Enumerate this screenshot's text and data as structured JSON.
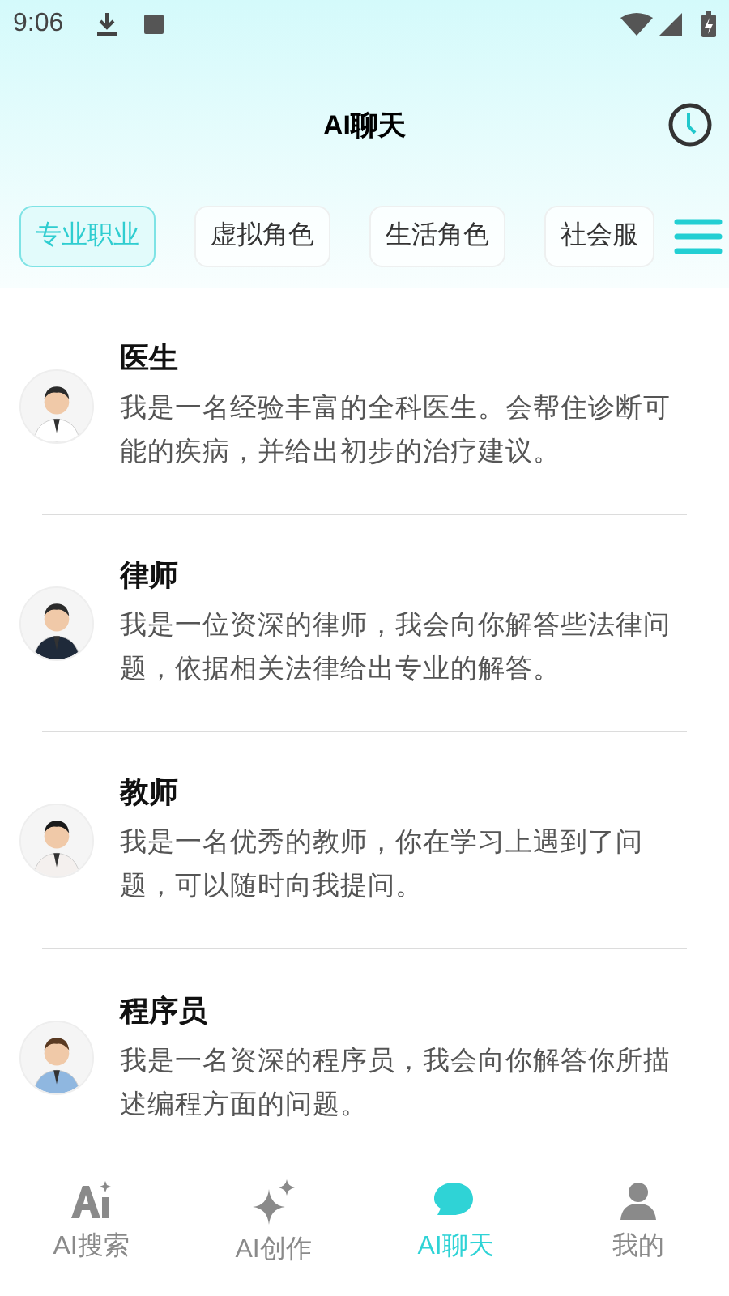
{
  "status_bar": {
    "time": "9:06"
  },
  "header": {
    "title": "AI聊天"
  },
  "categories": [
    {
      "label": "专业职业",
      "selected": true
    },
    {
      "label": "虚拟角色",
      "selected": false
    },
    {
      "label": "生活角色",
      "selected": false
    },
    {
      "label": "社会服",
      "selected": false
    }
  ],
  "roles": [
    {
      "name": "医生",
      "description": "我是一名经验丰富的全科医生。会帮住诊断可能的疾病，并给出初步的治疗建议。"
    },
    {
      "name": "律师",
      "description": "我是一位资深的律师，我会向你解答些法律问题，依据相关法律给出专业的解答。"
    },
    {
      "name": "教师",
      "description": "我是一名优秀的教师，你在学习上遇到了问题，可以随时向我提问。"
    },
    {
      "name": "程序员",
      "description": "我是一名资深的程序员，我会向你解答你所描述编程方面的问题。"
    }
  ],
  "bottom_nav": [
    {
      "label": "AI搜索",
      "kind": "search",
      "selected": false
    },
    {
      "label": "AI创作",
      "kind": "create",
      "selected": false
    },
    {
      "label": "AI聊天",
      "kind": "chat",
      "selected": true
    },
    {
      "label": "我的",
      "kind": "profile",
      "selected": false
    }
  ]
}
